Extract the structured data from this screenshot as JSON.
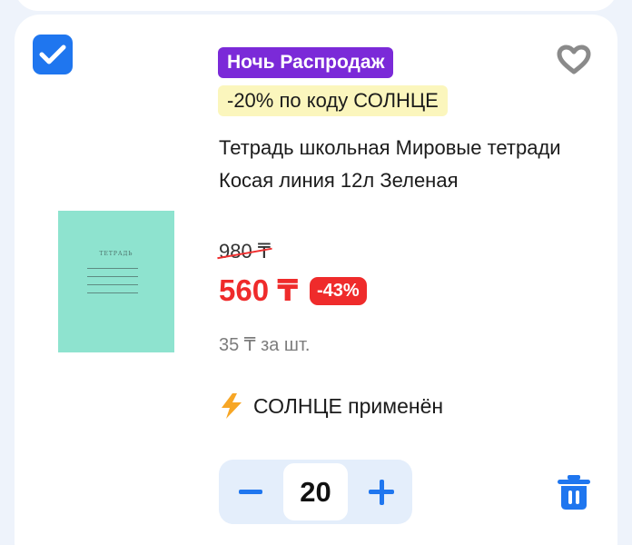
{
  "item": {
    "selected": true,
    "sale_badge": "Ночь Распродаж",
    "promo_badge": "-20% по коду СОЛНЦЕ",
    "title": "Тетрадь школьная Мировые тетради Косая линия 12л Зеленая",
    "old_price": "980 ₸",
    "price": "560 ₸",
    "discount": "-43%",
    "unit_price": "35 ₸ за шт.",
    "promo_applied": "СОЛНЦЕ применён",
    "quantity": "20",
    "thumbnail_caption": "ТЕТРАДЬ"
  },
  "icons": {
    "checkbox": "check-icon",
    "favorite": "heart-icon",
    "promo": "lightning-icon",
    "delete": "trash-icon",
    "decrement": "minus-icon",
    "increment": "plus-icon"
  },
  "colors": {
    "accent": "#1f76ef",
    "sale_badge_bg": "#7b2ad8",
    "promo_badge_bg": "#fbf6bd",
    "price": "#ef2b2b",
    "background": "#eef3fb"
  }
}
